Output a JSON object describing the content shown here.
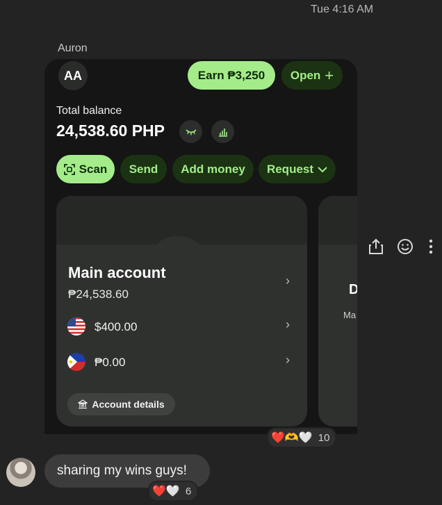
{
  "timestamp": "Tue 4:16 AM",
  "sender": "Auron",
  "card": {
    "avatar_initials": "AA",
    "earn_label": "Earn ₱3,250",
    "open_label": "Open",
    "total_label": "Total balance",
    "total_amount": "24,538.60 PHP",
    "actions": {
      "scan": "Scan",
      "send": "Send",
      "add_money": "Add money",
      "request": "Request"
    },
    "main_account": {
      "title": "Main account",
      "balance": "₱24,538.60",
      "usd": "$400.00",
      "php": "₱0.00",
      "details_label": "Account details"
    },
    "second_card": {
      "title_fragment": "D",
      "sub_fragment": "Ma"
    }
  },
  "reactions": [
    {
      "emojis": "❤️🫶🤍",
      "count": "10"
    },
    {
      "emojis": "❤️🤍",
      "count": "6"
    }
  ],
  "message": {
    "text": "sharing my wins guys!"
  },
  "colors": {
    "accent_green": "#a4ec8a",
    "dark_green": "#1b3312",
    "background": "#232323"
  }
}
